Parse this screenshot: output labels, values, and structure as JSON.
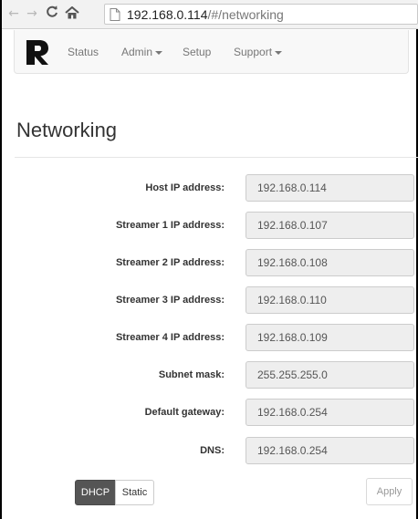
{
  "browser": {
    "url_host": "192.168.0.114",
    "url_path": "/#/networking"
  },
  "navbar": {
    "items": [
      {
        "label": "Status"
      },
      {
        "label": "Admin"
      },
      {
        "label": "Setup"
      },
      {
        "label": "Support"
      }
    ]
  },
  "page": {
    "title": "Networking"
  },
  "form": {
    "fields": [
      {
        "label": "Host IP address:",
        "value": "192.168.0.114"
      },
      {
        "label": "Streamer 1 IP address:",
        "value": "192.168.0.107"
      },
      {
        "label": "Streamer 2 IP address:",
        "value": "192.168.0.108"
      },
      {
        "label": "Streamer 3 IP address:",
        "value": "192.168.0.110"
      },
      {
        "label": "Streamer 4 IP address:",
        "value": "192.168.0.109"
      },
      {
        "label": "Subnet mask:",
        "value": "255.255.255.0"
      },
      {
        "label": "Default gateway:",
        "value": "192.168.0.254"
      },
      {
        "label": "DNS:",
        "value": "192.168.0.254"
      }
    ]
  },
  "actions": {
    "dhcp_label": "DHCP",
    "static_label": "Static",
    "apply_label": "Apply",
    "active_mode": "DHCP"
  },
  "colors": {
    "active_button": "#555555",
    "field_background": "#eeeeee"
  }
}
